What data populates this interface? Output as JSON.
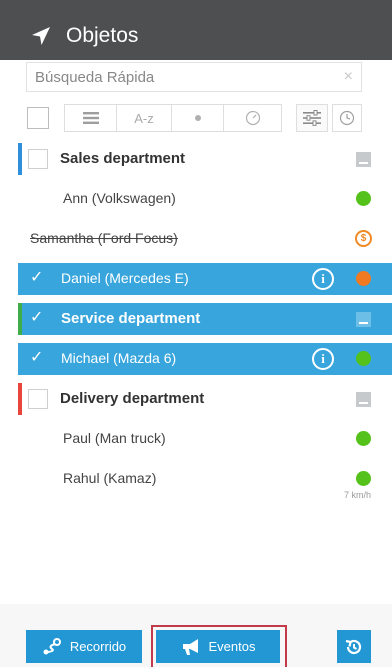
{
  "header": {
    "title": "Objetos",
    "icon": "location-arrow-icon"
  },
  "search": {
    "placeholder": "Búsqueda Rápida",
    "clear_icon": "×"
  },
  "toolbar": {
    "sort_label": "A-z"
  },
  "list": {
    "groups": [
      {
        "name": "Sales department",
        "color": "#2f8fdb",
        "selected": false,
        "objects": [
          {
            "name": "Ann (Volkswagen)",
            "status": "green",
            "selected": false,
            "strike": false
          },
          {
            "name": "Samantha (Ford Focus)",
            "status": "fuel-warning",
            "selected": false,
            "strike": true
          },
          {
            "name": "Daniel (Mercedes E)",
            "status": "orange",
            "selected": true,
            "strike": false
          }
        ]
      },
      {
        "name": "Service department",
        "color": "#3fae49",
        "selected": true,
        "objects": [
          {
            "name": "Michael (Mazda 6)",
            "status": "green",
            "selected": true,
            "strike": false
          }
        ]
      },
      {
        "name": "Delivery department",
        "color": "#e8463b",
        "selected": false,
        "objects": [
          {
            "name": "Paul (Man truck)",
            "status": "green",
            "selected": false,
            "strike": false
          },
          {
            "name": "Rahul (Kamaz)",
            "status": "green",
            "selected": false,
            "strike": false,
            "speed": "7 km/h"
          }
        ]
      }
    ]
  },
  "bottom": {
    "track_label": "Recorrido",
    "events_label": "Eventos"
  },
  "colors": {
    "header_bg": "#4d4f51",
    "accent": "#38a5dc",
    "status_green": "#55c21b",
    "status_orange": "#f07a22",
    "highlight_border": "#c23b4b"
  }
}
